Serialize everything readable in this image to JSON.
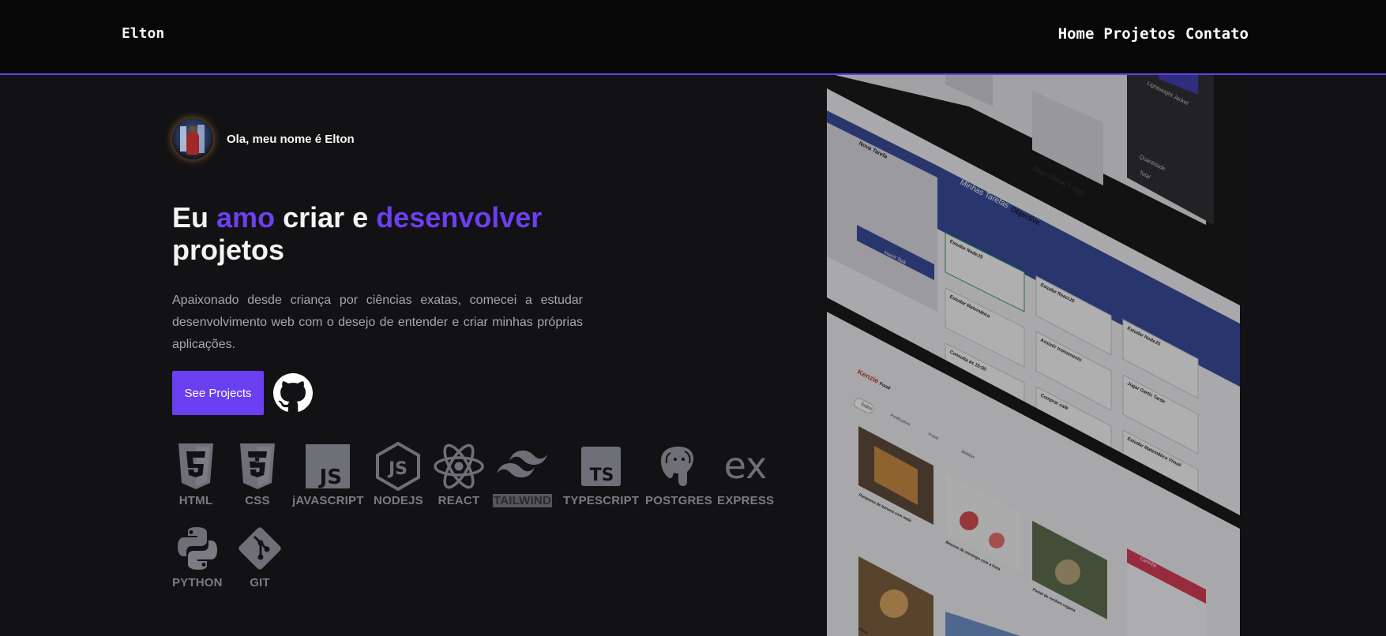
{
  "nav": {
    "brand": "Elton",
    "links": [
      "Home",
      "Projetos",
      "Contato"
    ]
  },
  "hero": {
    "greeting": "Ola, meu nome é Elton",
    "headline": {
      "w1": "Eu",
      "w2": "amo",
      "w3": "criar e",
      "w4": "desenvolver",
      "w5": "projetos"
    },
    "bio": "Apaixonado desde criança por ciências exatas, comecei a estudar desenvolvimento web com o desejo de entender e criar minhas próprias aplicações.",
    "cta": "See Projects"
  },
  "skills": [
    "HTML",
    "CSS",
    "jAVASCRIPT",
    "NODEJS",
    "REACT",
    "TAILWIND",
    "TYPESCRIPT",
    "POSTGRES",
    "EXPRESS",
    "PYTHON",
    "GIT"
  ],
  "preview": {
    "app1": {
      "panel_title": "Nova Tarefa",
      "title": "Minhas Tarefas",
      "logo": "Objective",
      "logo_suffix": "task",
      "button": "Inserir Task",
      "tasks": [
        "Estudar NodeJS",
        "Estudar ReactJS",
        "Estudar NodeJS",
        "Estudar Matemática",
        "Assistir treinamento",
        "Jogar Gartic Tarde",
        "Consulta às 15:00",
        "Comprar café",
        "Estudar Matemática Visual"
      ]
    },
    "app2": {
      "logo": "Kenzie",
      "logo_suffix": "Food",
      "filter": "Todos",
      "tags": [
        "Panificadora",
        "Frutas",
        "Bebidas"
      ],
      "items": [
        "Panqueca de banana com mela",
        "Mousse de morango com a fruta",
        "Pastel de verdura vegana",
        "Pizza"
      ],
      "cart": "Carrinho"
    },
    "app3": {
      "items": [
        "Short-Sleeve T-Shirt",
        "Champion Packable Jacket",
        "Lightweight Jacket",
        "T-Shirt",
        "Sweatshirt"
      ],
      "cart_labels": [
        "Quantidade",
        "Total"
      ]
    }
  },
  "colors": {
    "accent": "#6a3ff0",
    "background": "#121214",
    "navbar": "#070708"
  }
}
